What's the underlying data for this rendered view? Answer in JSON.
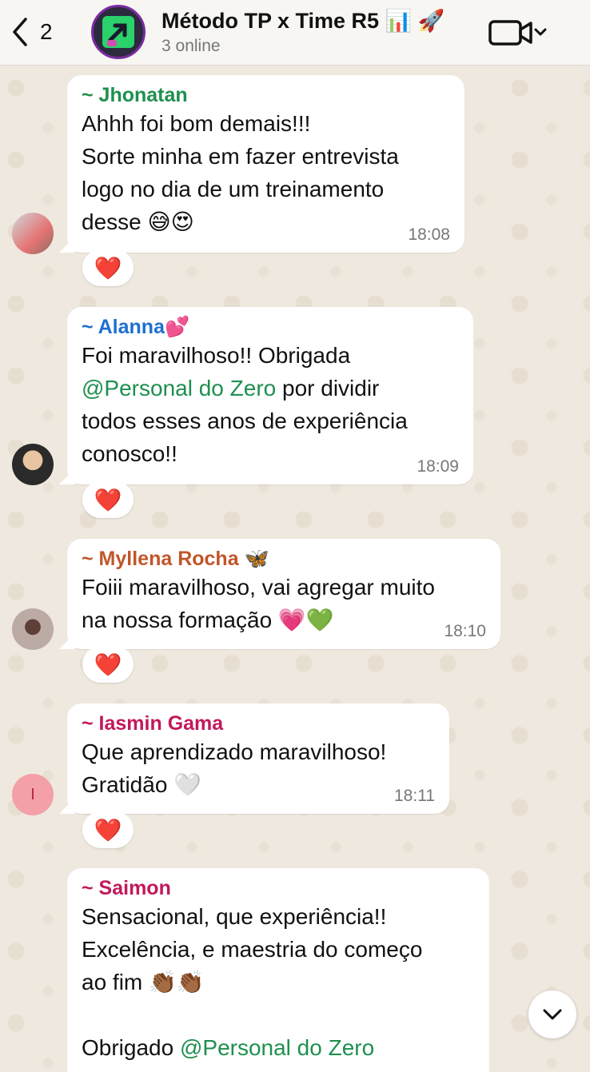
{
  "header": {
    "back_count": "2",
    "title": "Método TP x Time R5 📊 🚀",
    "subtitle": "3 online"
  },
  "messages": [
    {
      "sender": "~ Jhonatan",
      "sender_color": "#1f8f4f",
      "text": "Ahhh foi bom demais!!!\nSorte minha em fazer entrevista\nlogo no dia de um treinamento\ndesse 😅😍",
      "time": "18:08",
      "reaction": "❤️"
    },
    {
      "sender": "~ Alanna💕",
      "sender_color": "#1e6fd0",
      "text_before": "Foi maravilhoso!! Obrigada\n",
      "mention": "@Personal do Zero",
      "text_after": " por dividir\ntodos esses anos de experiência\nconosco!!",
      "time": "18:09",
      "reaction": "❤️"
    },
    {
      "sender": "~ Myllena Rocha 🦋",
      "sender_color": "#c0562a",
      "text": "Foiii maravilhoso, vai agregar muito\nna nossa formação 💗💚",
      "time": "18:10",
      "reaction": "❤️"
    },
    {
      "sender": "~ Iasmin Gama",
      "sender_color": "#c2185b",
      "text": "Que aprendizado maravilhoso!\nGratidão 🤍",
      "time": "18:11",
      "reaction": "❤️",
      "avatar_letter": "I"
    },
    {
      "sender": "~ Saimon",
      "sender_color": "#c2185b",
      "text": "Sensacional, que experiência!!\nExcelência, e maestria do começo\nao fim 👏🏾👏🏾\n\nObrigado ",
      "mention": "@Personal do Zero"
    }
  ]
}
